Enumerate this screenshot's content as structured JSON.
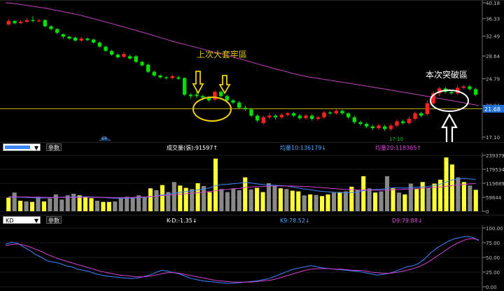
{
  "price_panel": {
    "axis_ticks": [
      "40.18",
      "36.33",
      "32.49",
      "28.64",
      "24.79",
      "20.94",
      "17.10"
    ],
    "current_price": "21.68",
    "x_label": "17:10",
    "marker": "64",
    "annotation_top": "上次大套牢區",
    "annotation_breakout": "本次突破區"
  },
  "volume_bar": {
    "setting_button": "參數",
    "label_volume": "成交量(張):91597↑",
    "label_ma10": "均量10:136179↓",
    "label_ma20": "均量20:118365↑"
  },
  "volume_panel": {
    "axis_ticks": [
      "239379",
      "179534",
      "119689",
      "59844",
      "0"
    ]
  },
  "kd_bar": {
    "combo_value": "KD",
    "setting_button": "參數",
    "label_kd": "K-D:-1.35↓",
    "label_k": "K9:78.52↓",
    "label_d": "D9:79.88↓"
  },
  "kd_panel": {
    "axis_ticks": [
      "100.00",
      "75.00",
      "50.00",
      "25.00",
      "0.00"
    ]
  },
  "colors": {
    "up": "#ff2020",
    "down": "#00e000",
    "ma_line": "#c040c0",
    "vol_up": "#ffff33",
    "vol_down": "#888888",
    "k_line": "#3a86ff",
    "d_line": "#d040d0",
    "annotation": "#e6c200"
  },
  "chart_data": [
    {
      "type": "candlestick",
      "yscale": "log",
      "ylim": [
        17.1,
        40.18
      ],
      "ma_line": [
        40.2,
        40.0,
        39.7,
        39.4,
        39.1,
        38.8,
        38.4,
        38.0,
        37.6,
        37.2,
        36.7,
        36.2,
        35.7,
        35.2,
        34.7,
        34.2,
        33.7,
        33.2,
        32.7,
        32.2,
        31.7,
        31.2,
        30.8,
        30.4,
        30.0,
        29.6,
        29.2,
        28.8,
        28.4,
        28.0,
        27.6,
        27.2,
        26.8,
        26.4,
        26.1,
        25.7,
        25.4,
        25.1,
        24.9,
        24.7,
        24.5,
        24.3,
        24.1,
        23.9,
        23.7,
        23.5,
        23.3,
        23.1,
        22.9,
        22.7,
        22.5,
        22.3,
        22.1,
        21.9,
        21.7,
        21.5,
        21.3,
        21.1,
        20.9
      ],
      "candles": [
        {
          "o": 35.0,
          "c": 35.8,
          "h": 36.2,
          "l": 34.8
        },
        {
          "o": 35.8,
          "c": 35.3,
          "h": 36.0,
          "l": 35.0
        },
        {
          "o": 35.3,
          "c": 35.6,
          "h": 36.0,
          "l": 35.1
        },
        {
          "o": 35.6,
          "c": 36.0,
          "h": 36.4,
          "l": 35.4
        },
        {
          "o": 36.0,
          "c": 35.8,
          "h": 36.9,
          "l": 35.5
        },
        {
          "o": 35.8,
          "c": 35.9,
          "h": 36.3,
          "l": 35.5
        },
        {
          "o": 36.0,
          "c": 34.6,
          "h": 36.2,
          "l": 34.4
        },
        {
          "o": 34.6,
          "c": 34.0,
          "h": 34.8,
          "l": 33.7
        },
        {
          "o": 34.0,
          "c": 33.2,
          "h": 34.2,
          "l": 32.9
        },
        {
          "o": 32.9,
          "c": 32.4,
          "h": 33.1,
          "l": 32.0
        },
        {
          "o": 32.4,
          "c": 32.0,
          "h": 32.6,
          "l": 31.8
        },
        {
          "o": 32.2,
          "c": 31.6,
          "h": 32.4,
          "l": 31.4
        },
        {
          "o": 31.6,
          "c": 32.0,
          "h": 32.3,
          "l": 31.4
        },
        {
          "o": 32.0,
          "c": 31.7,
          "h": 32.2,
          "l": 31.5
        },
        {
          "o": 31.8,
          "c": 31.2,
          "h": 32.0,
          "l": 31.0
        },
        {
          "o": 31.2,
          "c": 30.4,
          "h": 31.4,
          "l": 30.2
        },
        {
          "o": 30.4,
          "c": 29.6,
          "h": 30.6,
          "l": 29.4
        },
        {
          "o": 29.6,
          "c": 28.9,
          "h": 29.8,
          "l": 28.7
        },
        {
          "o": 28.9,
          "c": 28.4,
          "h": 29.1,
          "l": 28.2
        },
        {
          "o": 28.5,
          "c": 29.0,
          "h": 29.4,
          "l": 28.3
        },
        {
          "o": 28.6,
          "c": 28.2,
          "h": 28.9,
          "l": 28.0
        },
        {
          "o": 28.6,
          "c": 27.6,
          "h": 28.8,
          "l": 27.4
        },
        {
          "o": 27.6,
          "c": 27.0,
          "h": 27.8,
          "l": 26.8
        },
        {
          "o": 27.1,
          "c": 25.9,
          "h": 27.3,
          "l": 25.7
        },
        {
          "o": 25.9,
          "c": 25.3,
          "h": 26.1,
          "l": 25.1
        },
        {
          "o": 25.3,
          "c": 25.0,
          "h": 25.5,
          "l": 24.8
        },
        {
          "o": 25.0,
          "c": 24.9,
          "h": 25.2,
          "l": 24.7
        },
        {
          "o": 24.9,
          "c": 25.2,
          "h": 25.4,
          "l": 24.7
        },
        {
          "o": 25.0,
          "c": 24.8,
          "h": 25.3,
          "l": 24.6
        },
        {
          "o": 24.9,
          "c": 22.4,
          "h": 25.0,
          "l": 22.2
        },
        {
          "o": 22.4,
          "c": 22.2,
          "h": 22.6,
          "l": 21.8
        },
        {
          "o": 22.4,
          "c": 22.2,
          "h": 22.9,
          "l": 21.9
        },
        {
          "o": 22.2,
          "c": 22.0,
          "h": 22.4,
          "l": 21.6
        },
        {
          "o": 22.0,
          "c": 21.6,
          "h": 22.2,
          "l": 21.4
        },
        {
          "o": 21.7,
          "c": 22.8,
          "h": 23.0,
          "l": 21.5
        },
        {
          "o": 22.8,
          "c": 22.2,
          "h": 23.0,
          "l": 22.0
        },
        {
          "o": 22.2,
          "c": 21.6,
          "h": 22.4,
          "l": 21.4
        },
        {
          "o": 21.6,
          "c": 21.3,
          "h": 21.8,
          "l": 21.1
        },
        {
          "o": 21.3,
          "c": 20.6,
          "h": 21.5,
          "l": 20.4
        },
        {
          "o": 20.6,
          "c": 20.4,
          "h": 20.9,
          "l": 20.2
        },
        {
          "o": 20.4,
          "c": 19.6,
          "h": 20.6,
          "l": 19.4
        },
        {
          "o": 19.6,
          "c": 19.0,
          "h": 19.8,
          "l": 18.8
        },
        {
          "o": 18.7,
          "c": 19.4,
          "h": 19.6,
          "l": 18.5
        },
        {
          "o": 19.4,
          "c": 19.6,
          "h": 19.9,
          "l": 19.2
        },
        {
          "o": 19.6,
          "c": 19.4,
          "h": 19.8,
          "l": 19.1
        },
        {
          "o": 19.4,
          "c": 19.7,
          "h": 19.9,
          "l": 19.2
        },
        {
          "o": 19.7,
          "c": 19.9,
          "h": 20.1,
          "l": 19.5
        },
        {
          "o": 19.9,
          "c": 19.6,
          "h": 20.1,
          "l": 19.4
        },
        {
          "o": 19.6,
          "c": 19.3,
          "h": 19.8,
          "l": 19.1
        },
        {
          "o": 19.3,
          "c": 19.6,
          "h": 19.8,
          "l": 19.1
        },
        {
          "o": 19.6,
          "c": 19.2,
          "h": 19.8,
          "l": 19.0
        },
        {
          "o": 19.2,
          "c": 19.4,
          "h": 19.6,
          "l": 19.0
        },
        {
          "o": 19.4,
          "c": 20.0,
          "h": 20.2,
          "l": 19.2
        },
        {
          "o": 20.0,
          "c": 19.9,
          "h": 20.2,
          "l": 19.7
        },
        {
          "o": 19.9,
          "c": 20.2,
          "h": 20.4,
          "l": 19.7
        },
        {
          "o": 20.2,
          "c": 19.9,
          "h": 20.4,
          "l": 19.7
        },
        {
          "o": 19.9,
          "c": 19.4,
          "h": 20.0,
          "l": 19.2
        },
        {
          "o": 19.4,
          "c": 18.8,
          "h": 19.6,
          "l": 18.6
        },
        {
          "o": 18.8,
          "c": 18.6,
          "h": 19.0,
          "l": 18.4
        },
        {
          "o": 18.6,
          "c": 18.3,
          "h": 18.8,
          "l": 18.1
        },
        {
          "o": 18.3,
          "c": 18.1,
          "h": 18.5,
          "l": 17.9
        },
        {
          "o": 18.1,
          "c": 18.4,
          "h": 18.6,
          "l": 17.9
        },
        {
          "o": 18.3,
          "c": 18.0,
          "h": 18.5,
          "l": 17.8
        },
        {
          "o": 18.0,
          "c": 18.4,
          "h": 18.6,
          "l": 17.8
        },
        {
          "o": 18.4,
          "c": 18.9,
          "h": 19.1,
          "l": 18.2
        },
        {
          "o": 18.9,
          "c": 18.7,
          "h": 19.1,
          "l": 18.5
        },
        {
          "o": 18.7,
          "c": 19.2,
          "h": 19.5,
          "l": 18.5
        },
        {
          "o": 19.2,
          "c": 19.9,
          "h": 20.1,
          "l": 19.0
        },
        {
          "o": 19.9,
          "c": 19.6,
          "h": 20.1,
          "l": 19.4
        },
        {
          "o": 19.8,
          "c": 21.2,
          "h": 21.6,
          "l": 19.6
        },
        {
          "o": 21.2,
          "c": 22.6,
          "h": 22.9,
          "l": 21.0
        },
        {
          "o": 22.6,
          "c": 23.3,
          "h": 23.5,
          "l": 22.2
        },
        {
          "o": 23.3,
          "c": 22.8,
          "h": 23.5,
          "l": 22.6
        },
        {
          "o": 22.8,
          "c": 22.6,
          "h": 23.0,
          "l": 22.4
        },
        {
          "o": 22.6,
          "c": 23.4,
          "h": 23.8,
          "l": 22.4
        },
        {
          "o": 23.4,
          "c": 23.6,
          "h": 23.8,
          "l": 23.2
        },
        {
          "o": 23.6,
          "c": 23.2,
          "h": 23.8,
          "l": 23.0
        },
        {
          "o": 23.2,
          "c": 22.4,
          "h": 23.4,
          "l": 22.2
        }
      ]
    },
    {
      "type": "bar",
      "ylim": [
        0,
        239379
      ],
      "volumes": [
        58000,
        80000,
        45000,
        42000,
        40000,
        62000,
        42000,
        55000,
        72000,
        50000,
        68000,
        75000,
        68000,
        62000,
        56000,
        45000,
        40000,
        40000,
        42000,
        55000,
        62000,
        60000,
        68000,
        62000,
        98000,
        90000,
        112000,
        82000,
        125000,
        110000,
        100000,
        95000,
        120000,
        108000,
        82000,
        225000,
        95000,
        82000,
        98000,
        90000,
        145000,
        93000,
        100000,
        82000,
        120000,
        108000,
        98000,
        95000,
        88000,
        85000,
        68000,
        72000,
        70000,
        65000,
        72000,
        80000,
        82000,
        85000,
        105000,
        90000,
        150000,
        98000,
        80000,
        85000,
        150000,
        98000,
        80000,
        72000,
        118000,
        95000,
        125000,
        100000,
        118000,
        135000,
        230000,
        200000,
        145000,
        125000,
        110000,
        91597
      ],
      "vol_up_flags": [
        1,
        0,
        1,
        0,
        1,
        0,
        1,
        0,
        0,
        0,
        0,
        0,
        1,
        1,
        1,
        0,
        1,
        1,
        0,
        0,
        0,
        0,
        0,
        0,
        1,
        0,
        1,
        0,
        0,
        1,
        1,
        0,
        1,
        0,
        1,
        1,
        0,
        0,
        0,
        0,
        1,
        0,
        1,
        1,
        0,
        0,
        1,
        0,
        1,
        1,
        0,
        1,
        0,
        1,
        1,
        0,
        1,
        0,
        1,
        0,
        1,
        0,
        1,
        0,
        0,
        1,
        0,
        1,
        0,
        1,
        1,
        0,
        1,
        1,
        1,
        1,
        0,
        1,
        0,
        1
      ],
      "ma10": [
        60000,
        61000,
        60000,
        59000,
        58000,
        57000,
        57000,
        58000,
        59000,
        60000,
        60000,
        61000,
        62000,
        62000,
        61000,
        60000,
        59000,
        57000,
        56000,
        55000,
        56000,
        57000,
        58000,
        59000,
        62000,
        66000,
        70000,
        73000,
        77000,
        81000,
        85000,
        88000,
        91000,
        96000,
        100000,
        110000,
        114000,
        115000,
        118000,
        120000,
        123000,
        121000,
        117000,
        114000,
        112000,
        111000,
        110000,
        108000,
        104000,
        100000,
        95000,
        92000,
        88000,
        85000,
        83000,
        81000,
        80000,
        79000,
        80000,
        82000,
        88000,
        92000,
        93000,
        94000,
        98000,
        100000,
        100000,
        99000,
        101000,
        103000,
        105000,
        106000,
        111000,
        116000,
        125000,
        134000,
        138000,
        140000,
        138000,
        136179
      ],
      "ma20": [
        62000,
        62000,
        61000,
        61000,
        60000,
        60000,
        59000,
        59000,
        59000,
        59000,
        59000,
        59000,
        60000,
        60000,
        60000,
        59000,
        59000,
        59000,
        58000,
        58000,
        58000,
        59000,
        60000,
        61000,
        63000,
        65000,
        67000,
        69000,
        71000,
        73000,
        75000,
        77000,
        79000,
        82000,
        85000,
        88000,
        91000,
        93000,
        96000,
        98000,
        102000,
        104000,
        105000,
        106000,
        107000,
        108000,
        108000,
        108000,
        108000,
        107000,
        106000,
        105000,
        103000,
        101000,
        99000,
        97000,
        95000,
        93000,
        92000,
        91000,
        91000,
        91000,
        90000,
        90000,
        91000,
        92000,
        93000,
        94000,
        95000,
        97000,
        99000,
        100000,
        102000,
        104000,
        107000,
        110000,
        113000,
        115000,
        117000,
        118365
      ]
    },
    {
      "type": "line",
      "ylim": [
        0,
        100
      ],
      "k": [
        72,
        76,
        74,
        68,
        62,
        55,
        50,
        44,
        42,
        40,
        36,
        34,
        30,
        28,
        26,
        22,
        20,
        18,
        17,
        16,
        15,
        14,
        15,
        17,
        20,
        24,
        28,
        27,
        24,
        22,
        18,
        14,
        12,
        10,
        9,
        8,
        7,
        6,
        6,
        7,
        8,
        9,
        10,
        12,
        14,
        18,
        22,
        26,
        30,
        32,
        34,
        36,
        34,
        32,
        31,
        30,
        29,
        28,
        27,
        26,
        24,
        22,
        20,
        21,
        23,
        26,
        30,
        34,
        36,
        40,
        48,
        58,
        66,
        72,
        78,
        82,
        84,
        86,
        84,
        78.52
      ],
      "d": [
        70,
        72,
        73,
        71,
        68,
        64,
        60,
        55,
        51,
        47,
        44,
        41,
        38,
        35,
        32,
        29,
        26,
        24,
        22,
        20,
        19,
        18,
        17,
        17,
        18,
        20,
        22,
        24,
        24,
        23,
        21,
        19,
        17,
        15,
        13,
        11,
        10,
        9,
        8,
        8,
        8,
        8,
        9,
        10,
        11,
        13,
        16,
        19,
        22,
        25,
        28,
        30,
        31,
        31,
        31,
        30,
        30,
        29,
        28,
        28,
        27,
        25,
        24,
        23,
        23,
        24,
        26,
        28,
        31,
        34,
        39,
        45,
        52,
        59,
        66,
        72,
        77,
        81,
        82,
        79.88
      ]
    }
  ]
}
